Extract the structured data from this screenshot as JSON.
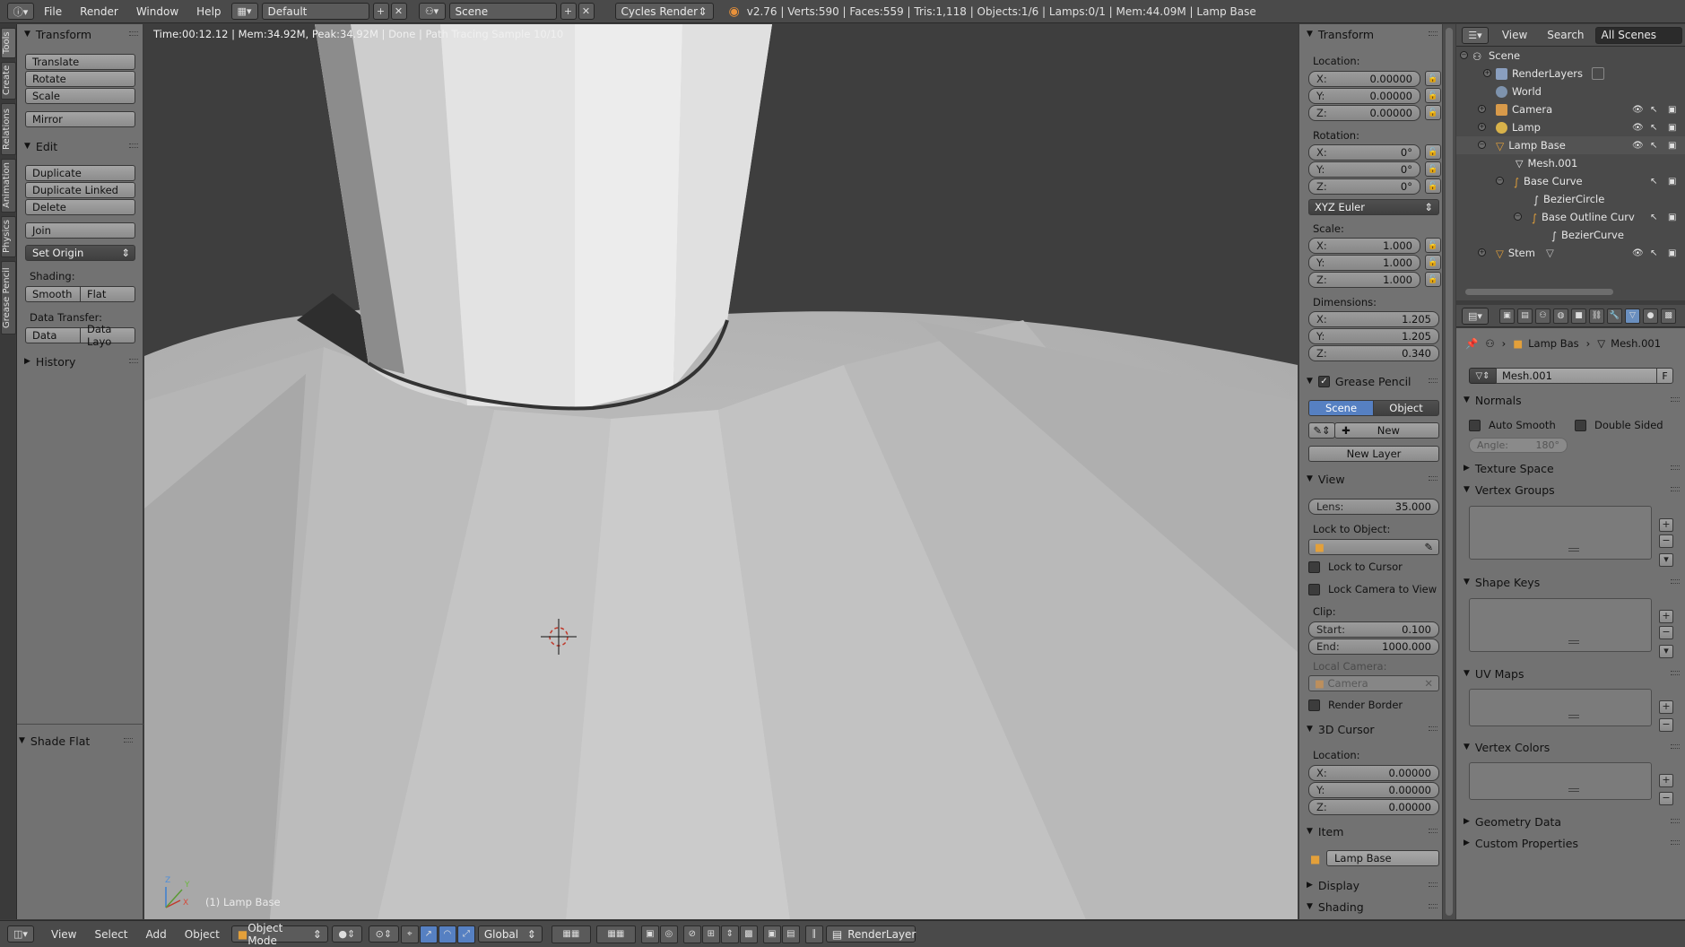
{
  "topbar": {
    "menus": [
      "File",
      "Render",
      "Window",
      "Help"
    ],
    "screen_layout": "Default",
    "scene": "Scene",
    "render_engine": "Cycles Render",
    "stats": "v2.76 | Verts:590 | Faces:559 | Tris:1,118 | Objects:1/6 | Lamps:0/1 | Mem:44.09M | Lamp Base"
  },
  "left_tabs": [
    "Tools",
    "Create",
    "Relations",
    "Animation",
    "Physics",
    "Grease Pencil"
  ],
  "tool_shelf": {
    "transform_header": "Transform",
    "translate": "Translate",
    "rotate": "Rotate",
    "scale": "Scale",
    "mirror": "Mirror",
    "edit_header": "Edit",
    "duplicate": "Duplicate",
    "duplicate_linked": "Duplicate Linked",
    "delete": "Delete",
    "join": "Join",
    "set_origin": "Set Origin",
    "shading_label": "Shading:",
    "smooth": "Smooth",
    "flat": "Flat",
    "data_transfer_label": "Data Transfer:",
    "data": "Data",
    "data_layout": "Data Layo",
    "history_header": "History",
    "operator_header": "Shade Flat"
  },
  "viewport": {
    "render_info": "Time:00:12.12 | Mem:34.92M, Peak:34.92M | Done | Path Tracing Sample 10/10",
    "object_label": "(1) Lamp Base",
    "axis_x": "X",
    "axis_y": "Y",
    "axis_z": "Z"
  },
  "npanel": {
    "transform_header": "Transform",
    "location_label": "Location:",
    "location": [
      {
        "axis": "X:",
        "value": "0.00000"
      },
      {
        "axis": "Y:",
        "value": "0.00000"
      },
      {
        "axis": "Z:",
        "value": "0.00000"
      }
    ],
    "rotation_label": "Rotation:",
    "rotation": [
      {
        "axis": "X:",
        "value": "0°"
      },
      {
        "axis": "Y:",
        "value": "0°"
      },
      {
        "axis": "Z:",
        "value": "0°"
      }
    ],
    "rotation_mode": "XYZ Euler",
    "scale_label": "Scale:",
    "scale": [
      {
        "axis": "X:",
        "value": "1.000"
      },
      {
        "axis": "Y:",
        "value": "1.000"
      },
      {
        "axis": "Z:",
        "value": "1.000"
      }
    ],
    "dimensions_label": "Dimensions:",
    "dimensions": [
      {
        "axis": "X:",
        "value": "1.205"
      },
      {
        "axis": "Y:",
        "value": "1.205"
      },
      {
        "axis": "Z:",
        "value": "0.340"
      }
    ],
    "grease_pencil_header": "Grease Pencil",
    "gp_scene": "Scene",
    "gp_object": "Object",
    "gp_new": "New",
    "gp_new_layer": "New Layer",
    "view_header": "View",
    "lens_label": "Lens:",
    "lens_value": "35.000",
    "lock_to_object_label": "Lock to Object:",
    "lock_to_cursor": "Lock to Cursor",
    "lock_camera_to_view": "Lock Camera to View",
    "clip_label": "Clip:",
    "clip_start_label": "Start:",
    "clip_start": "0.100",
    "clip_end_label": "End:",
    "clip_end": "1000.000",
    "local_camera_label": "Local Camera:",
    "local_camera": "Camera",
    "render_border": "Render Border",
    "cursor_header": "3D Cursor",
    "cursor_location_label": "Location:",
    "cursor": [
      {
        "axis": "X:",
        "value": "0.00000"
      },
      {
        "axis": "Y:",
        "value": "0.00000"
      },
      {
        "axis": "Z:",
        "value": "0.00000"
      }
    ],
    "item_header": "Item",
    "item_name": "Lamp Base",
    "display_header": "Display",
    "shading_header": "Shading"
  },
  "outliner": {
    "view": "View",
    "search": "Search",
    "filter": "All Scenes",
    "rows": [
      "Scene",
      "RenderLayers",
      "World",
      "Camera",
      "Lamp",
      "Lamp Base",
      "Mesh.001",
      "Base Curve",
      "BezierCircle",
      "Base Outline Curv",
      "BezierCurve",
      "Stem"
    ]
  },
  "properties": {
    "breadcrumb_object": "Lamp Bas",
    "breadcrumb_mesh": "Mesh.001",
    "mesh_name": "Mesh.001",
    "fake_user": "F",
    "normals_header": "Normals",
    "auto_smooth": "Auto Smooth",
    "double_sided": "Double Sided",
    "angle_label": "Angle:",
    "angle_value": "180°",
    "texture_space": "Texture Space",
    "vertex_groups": "Vertex Groups",
    "shape_keys": "Shape Keys",
    "uv_maps": "UV Maps",
    "vertex_colors": "Vertex Colors",
    "geometry_data": "Geometry Data",
    "custom_properties": "Custom Properties"
  },
  "bottombar": {
    "menus": [
      "View",
      "Select",
      "Add",
      "Object"
    ],
    "mode": "Object Mode",
    "orientation": "Global",
    "render_layer": "RenderLayer"
  },
  "colors": {
    "accent_blue": "#5680c2",
    "panel_bg": "#727272",
    "header_bg": "#4a4a4a"
  }
}
